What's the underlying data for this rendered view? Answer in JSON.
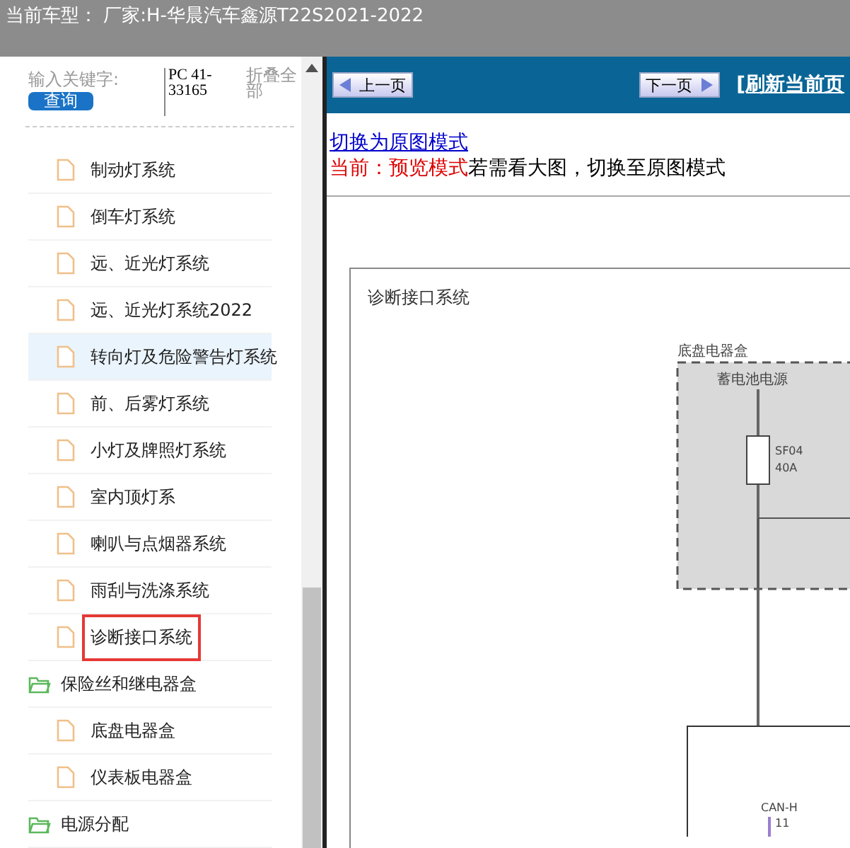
{
  "header": {
    "title": "当前车型：  厂家:H-华晨汽车鑫源T22S2021-2022"
  },
  "search": {
    "label": "输入关键字:",
    "button": "查询",
    "value": "PC 41-33165",
    "collapse": "折叠全部"
  },
  "tree": {
    "continued_children": [
      {
        "label": "制动灯系统",
        "selected": false,
        "highlighted": false
      },
      {
        "label": "倒车灯系统",
        "selected": false,
        "highlighted": false
      },
      {
        "label": "远、近光灯系统",
        "selected": false,
        "highlighted": false
      },
      {
        "label": "远、近光灯系统2022",
        "selected": false,
        "highlighted": false
      },
      {
        "label": "转向灯及危险警告灯系统",
        "selected": false,
        "highlighted": true
      },
      {
        "label": "前、后雾灯系统",
        "selected": false,
        "highlighted": false
      },
      {
        "label": "小灯及牌照灯系统",
        "selected": false,
        "highlighted": false
      },
      {
        "label": "室内顶灯系",
        "selected": false,
        "highlighted": false
      },
      {
        "label": "喇叭与点烟器系统",
        "selected": false,
        "highlighted": false
      },
      {
        "label": "雨刮与洗涤系统",
        "selected": false,
        "highlighted": false
      },
      {
        "label": "诊断接口系统",
        "selected": true,
        "highlighted": false
      }
    ],
    "folders": [
      {
        "label": "保险丝和继电器盒",
        "children": [
          {
            "label": "底盘电器盒",
            "selected": false,
            "highlighted": false
          },
          {
            "label": "仪表板电器盒",
            "selected": false,
            "highlighted": false
          }
        ]
      },
      {
        "label": "电源分配"
      }
    ]
  },
  "toolbar": {
    "prev": "上一页",
    "next": "下一页",
    "refresh": "[刷新当前页"
  },
  "mode": {
    "link": "切换为原图模式",
    "current": "当前：预览模式",
    "hint": "若需看大图，切换至原图模式"
  },
  "diagram": {
    "title": "诊断接口系统",
    "box_label": "底盘电器盒",
    "source": "蓄电池电源",
    "fuse_name": "SF04",
    "fuse_rating": "40A",
    "signal": "CAN-H",
    "pin": "11"
  }
}
